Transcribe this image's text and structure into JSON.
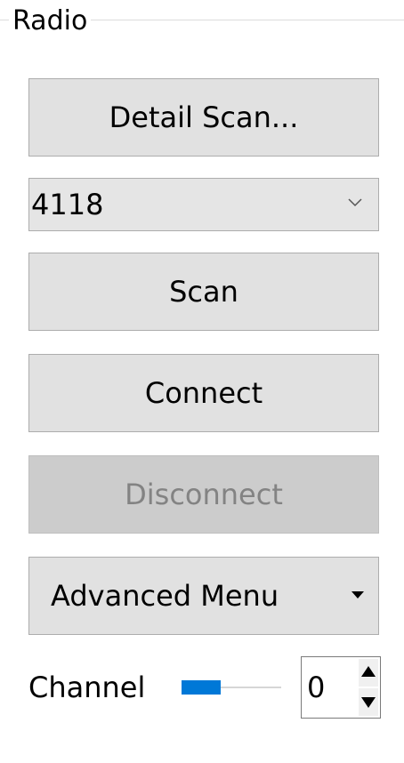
{
  "group": {
    "title": "Radio"
  },
  "buttons": {
    "detail_scan": "Detail Scan...",
    "scan": "Scan",
    "connect": "Connect",
    "disconnect": "Disconnect",
    "advanced_menu": "Advanced Menu"
  },
  "device_select": {
    "selected": "4118",
    "icon": "chevron-down-icon"
  },
  "channel": {
    "label": "Channel",
    "slider_fraction": 0,
    "value": "0"
  },
  "colors": {
    "accent": "#0078d7",
    "button_bg": "#e1e1e1",
    "disabled_bg": "#cccccc",
    "disabled_text": "#838383"
  }
}
